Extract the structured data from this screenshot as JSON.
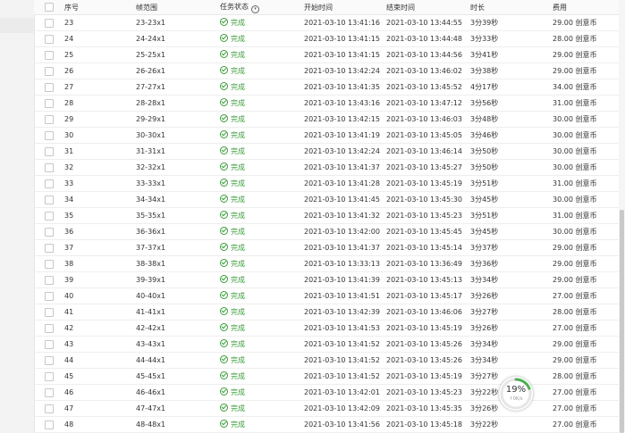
{
  "columns": {
    "seq": "序号",
    "range": "帧范围",
    "status": "任务状态",
    "start": "开始时间",
    "end": "结束时间",
    "duration": "时长",
    "cost": "费用"
  },
  "rows": [
    {
      "seq": "23",
      "range": "23-23x1",
      "status": "完成",
      "start": "2021-03-10 13:41:16",
      "end": "2021-03-10 13:44:55",
      "duration": "3分39秒",
      "cost": "29.00 创意币"
    },
    {
      "seq": "24",
      "range": "24-24x1",
      "status": "完成",
      "start": "2021-03-10 13:41:15",
      "end": "2021-03-10 13:44:48",
      "duration": "3分33秒",
      "cost": "28.00 创意币"
    },
    {
      "seq": "25",
      "range": "25-25x1",
      "status": "完成",
      "start": "2021-03-10 13:41:15",
      "end": "2021-03-10 13:44:56",
      "duration": "3分41秒",
      "cost": "29.00 创意币"
    },
    {
      "seq": "26",
      "range": "26-26x1",
      "status": "完成",
      "start": "2021-03-10 13:42:24",
      "end": "2021-03-10 13:46:02",
      "duration": "3分38秒",
      "cost": "29.00 创意币"
    },
    {
      "seq": "27",
      "range": "27-27x1",
      "status": "完成",
      "start": "2021-03-10 13:41:35",
      "end": "2021-03-10 13:45:52",
      "duration": "4分17秒",
      "cost": "34.00 创意币"
    },
    {
      "seq": "28",
      "range": "28-28x1",
      "status": "完成",
      "start": "2021-03-10 13:43:16",
      "end": "2021-03-10 13:47:12",
      "duration": "3分56秒",
      "cost": "31.00 创意币"
    },
    {
      "seq": "29",
      "range": "29-29x1",
      "status": "完成",
      "start": "2021-03-10 13:42:15",
      "end": "2021-03-10 13:46:03",
      "duration": "3分48秒",
      "cost": "30.00 创意币"
    },
    {
      "seq": "30",
      "range": "30-30x1",
      "status": "完成",
      "start": "2021-03-10 13:41:19",
      "end": "2021-03-10 13:45:05",
      "duration": "3分46秒",
      "cost": "30.00 创意币"
    },
    {
      "seq": "31",
      "range": "31-31x1",
      "status": "完成",
      "start": "2021-03-10 13:42:24",
      "end": "2021-03-10 13:46:14",
      "duration": "3分50秒",
      "cost": "30.00 创意币"
    },
    {
      "seq": "32",
      "range": "32-32x1",
      "status": "完成",
      "start": "2021-03-10 13:41:37",
      "end": "2021-03-10 13:45:27",
      "duration": "3分50秒",
      "cost": "30.00 创意币"
    },
    {
      "seq": "33",
      "range": "33-33x1",
      "status": "完成",
      "start": "2021-03-10 13:41:28",
      "end": "2021-03-10 13:45:19",
      "duration": "3分51秒",
      "cost": "31.00 创意币"
    },
    {
      "seq": "34",
      "range": "34-34x1",
      "status": "完成",
      "start": "2021-03-10 13:41:45",
      "end": "2021-03-10 13:45:30",
      "duration": "3分45秒",
      "cost": "30.00 创意币"
    },
    {
      "seq": "35",
      "range": "35-35x1",
      "status": "完成",
      "start": "2021-03-10 13:41:32",
      "end": "2021-03-10 13:45:23",
      "duration": "3分51秒",
      "cost": "31.00 创意币"
    },
    {
      "seq": "36",
      "range": "36-36x1",
      "status": "完成",
      "start": "2021-03-10 13:42:00",
      "end": "2021-03-10 13:45:45",
      "duration": "3分45秒",
      "cost": "30.00 创意币"
    },
    {
      "seq": "37",
      "range": "37-37x1",
      "status": "完成",
      "start": "2021-03-10 13:41:37",
      "end": "2021-03-10 13:45:14",
      "duration": "3分37秒",
      "cost": "29.00 创意币"
    },
    {
      "seq": "38",
      "range": "38-38x1",
      "status": "完成",
      "start": "2021-03-10 13:33:13",
      "end": "2021-03-10 13:36:49",
      "duration": "3分36秒",
      "cost": "29.00 创意币"
    },
    {
      "seq": "39",
      "range": "39-39x1",
      "status": "完成",
      "start": "2021-03-10 13:41:39",
      "end": "2021-03-10 13:45:13",
      "duration": "3分34秒",
      "cost": "29.00 创意币"
    },
    {
      "seq": "40",
      "range": "40-40x1",
      "status": "完成",
      "start": "2021-03-10 13:41:51",
      "end": "2021-03-10 13:45:17",
      "duration": "3分26秒",
      "cost": "27.00 创意币"
    },
    {
      "seq": "41",
      "range": "41-41x1",
      "status": "完成",
      "start": "2021-03-10 13:42:39",
      "end": "2021-03-10 13:46:06",
      "duration": "3分27秒",
      "cost": "28.00 创意币"
    },
    {
      "seq": "42",
      "range": "42-42x1",
      "status": "完成",
      "start": "2021-03-10 13:41:53",
      "end": "2021-03-10 13:45:19",
      "duration": "3分26秒",
      "cost": "27.00 创意币"
    },
    {
      "seq": "43",
      "range": "43-43x1",
      "status": "完成",
      "start": "2021-03-10 13:41:52",
      "end": "2021-03-10 13:45:26",
      "duration": "3分34秒",
      "cost": "29.00 创意币"
    },
    {
      "seq": "44",
      "range": "44-44x1",
      "status": "完成",
      "start": "2021-03-10 13:41:52",
      "end": "2021-03-10 13:45:26",
      "duration": "3分34秒",
      "cost": "29.00 创意币"
    },
    {
      "seq": "45",
      "range": "45-45x1",
      "status": "完成",
      "start": "2021-03-10 13:41:52",
      "end": "2021-03-10 13:45:19",
      "duration": "3分27秒",
      "cost": "28.00 创意币"
    },
    {
      "seq": "46",
      "range": "46-46x1",
      "status": "完成",
      "start": "2021-03-10 13:42:01",
      "end": "2021-03-10 13:45:23",
      "duration": "3分22秒",
      "cost": "27.00 创意币"
    },
    {
      "seq": "47",
      "range": "47-47x1",
      "status": "完成",
      "start": "2021-03-10 13:42:09",
      "end": "2021-03-10 13:45:35",
      "duration": "3分26秒",
      "cost": "27.00 创意币"
    },
    {
      "seq": "48",
      "range": "48-48x1",
      "status": "完成",
      "start": "2021-03-10 13:41:56",
      "end": "2021-03-10 13:45:18",
      "duration": "3分22秒",
      "cost": "27.00 创意币"
    }
  ],
  "progress_widget": {
    "percent": "19%",
    "value": 0.19,
    "sub": "↑0K/s"
  },
  "colors": {
    "success": "#3a9e3a",
    "progress_ring": "#4caf50"
  },
  "icons": {
    "status": "check-circle-icon",
    "filter": "filter-icon"
  }
}
